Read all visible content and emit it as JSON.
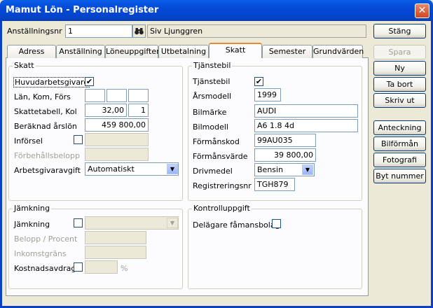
{
  "window": {
    "title": "Mamut Lön - Personalregister",
    "close_glyph": "✕"
  },
  "header": {
    "employee_number_label": "Anställningsnr",
    "employee_number_value": "1",
    "employee_name": "Siv Ljunggren",
    "close_button": "Stäng"
  },
  "tabs": [
    {
      "label": "Adress",
      "active": false
    },
    {
      "label": "Anställning",
      "active": false
    },
    {
      "label": "Löneuppgifter",
      "active": false
    },
    {
      "label": "Utbetalning",
      "active": false
    },
    {
      "label": "Skatt",
      "active": true
    },
    {
      "label": "Semester",
      "active": false
    },
    {
      "label": "Grundvärden",
      "active": false
    }
  ],
  "skatt": {
    "title": "Skatt",
    "huvudarbetsgivare_label": "Huvudarbetsgivare",
    "huvudarbetsgivare_checked": true,
    "lan_label": "Län, Kom, Förs",
    "lan_values": [
      "",
      "",
      ""
    ],
    "skattetabell_label": "Skattetabell, Kol",
    "skattetabell_value": "32,00",
    "kolumn_value": "1",
    "arslon_label": "Beräknad årslön",
    "arslon_value": "459 800,00",
    "inforsel_label": "Införsel",
    "inforsel_value": "",
    "forbehall_label": "Förbehållsbelopp",
    "forbehall_value": "",
    "avgift_label": "Arbetsgivaravgift",
    "avgift_value": "Automatiskt"
  },
  "jamkning": {
    "title": "Jämkning",
    "jamkning_label": "Jämkning",
    "jamkning_value": "",
    "belopp_label": "Belopp / Procent",
    "inkomst_label": "Inkomstgräns",
    "kostnad_label": "Kostnadsavdrag",
    "percent_sign": "%"
  },
  "tjanstebil": {
    "title": "Tjänstebil",
    "tjanstebil_label": "Tjänstebil",
    "tjanstebil_checked": true,
    "arsmodell_label": "Årsmodell",
    "arsmodell_value": "1999",
    "bilmarke_label": "Bilmärke",
    "bilmarke_value": "AUDI",
    "bilmodell_label": "Bilmodell",
    "bilmodell_value": "A6 1.8 4d",
    "formanskod_label": "Förmånskod",
    "formanskod_value": "99AU035",
    "formansvarde_label": "Förmånsvärde",
    "formansvarde_value": "39 800,00",
    "drivmedel_label": "Drivmedel",
    "drivmedel_value": "Bensin",
    "regnr_label": "Registreringsnr",
    "regnr_value": "TGH879"
  },
  "kontroll": {
    "title": "Kontrolluppgift",
    "delagare_label": "Delägare fåmansbolag"
  },
  "side_buttons": {
    "spara": "Spara",
    "ny": "Ny",
    "ta_bort": "Ta bort",
    "skriv_ut": "Skriv ut",
    "anteckning": "Anteckning",
    "bilforman": "Bilförmån",
    "fotografi": "Fotografi",
    "byt_nummer": "Byt nummer"
  },
  "icons": {
    "search": "binoculars-icon",
    "dropdown": "chevron-down-icon",
    "check": "✔"
  }
}
